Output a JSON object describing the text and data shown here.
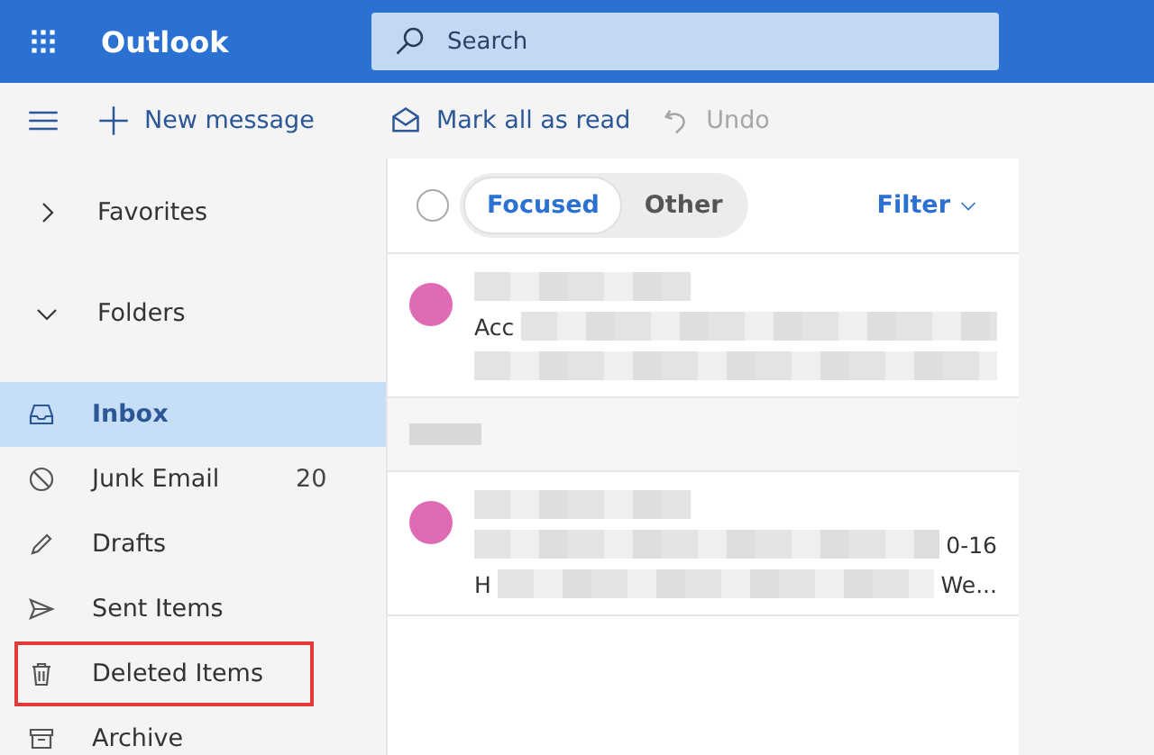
{
  "app": {
    "title": "Outlook"
  },
  "search": {
    "placeholder": "Search"
  },
  "toolbar": {
    "new_message": "New message",
    "actions": [
      {
        "label": "Mark all as read",
        "kind": "mark",
        "disabled": false
      },
      {
        "label": "Undo",
        "kind": "undo",
        "disabled": true
      }
    ]
  },
  "sidebar": {
    "sections": [
      {
        "label": "Favorites",
        "expanded": false
      },
      {
        "label": "Folders",
        "expanded": true
      }
    ],
    "folders": [
      {
        "label": "Inbox",
        "kind": "inbox",
        "selected": true,
        "highlighted": false
      },
      {
        "label": "Junk Email",
        "kind": "junk",
        "count": "20",
        "selected": false,
        "highlighted": false
      },
      {
        "label": "Drafts",
        "kind": "drafts",
        "selected": false,
        "highlighted": false
      },
      {
        "label": "Sent Items",
        "kind": "sent",
        "selected": false,
        "highlighted": false
      },
      {
        "label": "Deleted Items",
        "kind": "deleted",
        "selected": false,
        "highlighted": true
      },
      {
        "label": "Archive",
        "kind": "archive",
        "selected": false,
        "highlighted": false
      }
    ]
  },
  "message_list": {
    "select_all": {
      "checked": false
    },
    "tabs": [
      {
        "label": "Focused",
        "selected": true
      },
      {
        "label": "Other",
        "selected": false
      }
    ],
    "filter": "Filter",
    "items": [
      {
        "kind": "message",
        "preview": "Acc"
      },
      {
        "kind": "group"
      },
      {
        "kind": "message",
        "date": "0-16",
        "preview": "H",
        "preview_end": "We..."
      }
    ]
  }
}
